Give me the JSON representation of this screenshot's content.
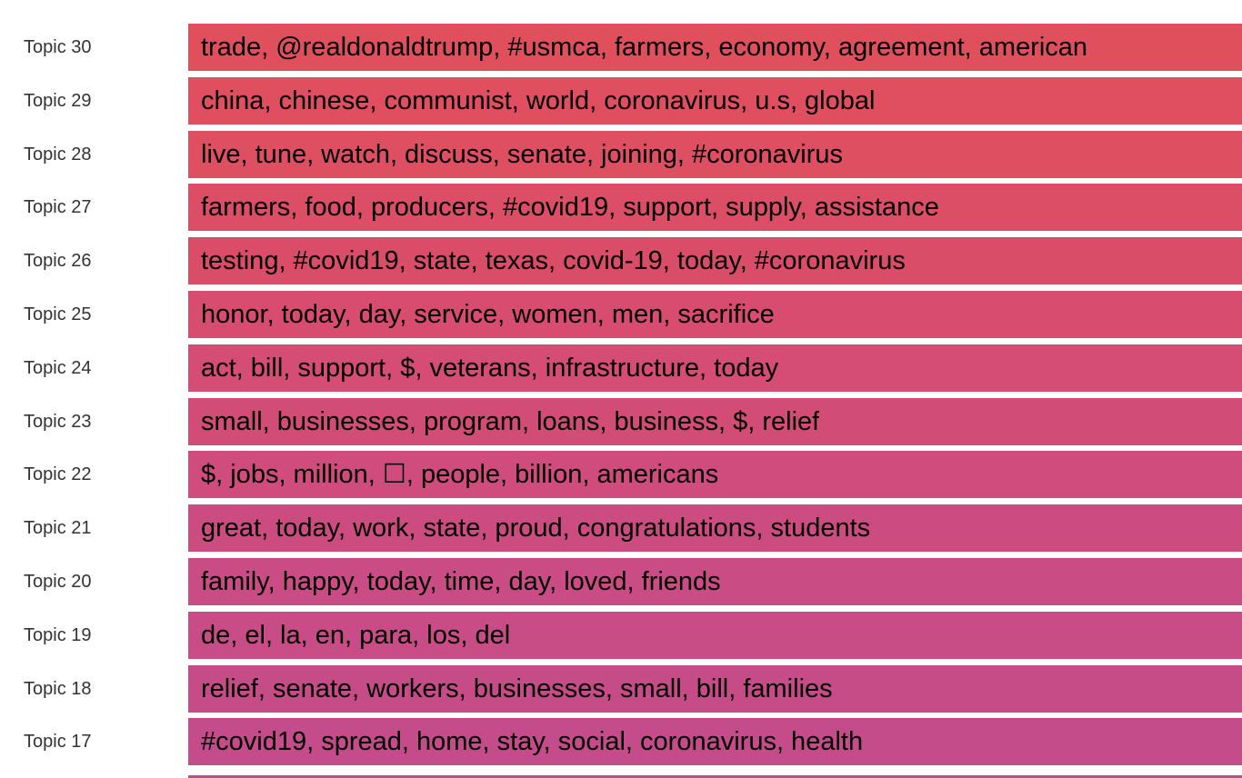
{
  "chart_data": {
    "type": "table",
    "rows": [
      {
        "label": "Topic 30",
        "words": "trade, @realdonaldtrump, #usmca, farmers, economy, agreement, american",
        "color": "#e0505c"
      },
      {
        "label": "Topic 29",
        "words": "china, chinese, communist, world, coronavirus, u.s, global",
        "color": "#df4f5f"
      },
      {
        "label": "Topic 28",
        "words": "live, tune, watch, discuss, senate, joining, #coronavirus",
        "color": "#de4f62"
      },
      {
        "label": "Topic 27",
        "words": "farmers, food, producers, #covid19, support, supply, assistance",
        "color": "#dc4e66"
      },
      {
        "label": "Topic 26",
        "words": "testing, #covid19, state, texas, covid-19, today, #coronavirus",
        "color": "#da4d69"
      },
      {
        "label": "Topic 25",
        "words": "honor, today, day, service, women, men, sacrifice",
        "color": "#d74c6f"
      },
      {
        "label": "Topic 24",
        "words": "act, bill, support, $, veterans, infrastructure, today",
        "color": "#d54c74"
      },
      {
        "label": "Topic 23",
        "words": "small, businesses, program, loans, business, $, relief",
        "color": "#d24c78"
      },
      {
        "label": "Topic 22",
        "words": "$, jobs, million, ☐, people, billion, americans",
        "color": "#cf4c7d"
      },
      {
        "label": "Topic 21",
        "words": "great, today, work, state, proud, congratulations, students",
        "color": "#cc4c81"
      },
      {
        "label": "Topic 20",
        "words": "family, happy, today, time, day, loved, friends",
        "color": "#ca4c84"
      },
      {
        "label": "Topic 19",
        "words": "de, el, la, en, para, los, del",
        "color": "#c84c86"
      },
      {
        "label": "Topic 18",
        "words": "relief, senate, workers, businesses, small, bill, families",
        "color": "#c64c88"
      },
      {
        "label": "Topic 17",
        "words": "#covid19, spread, home, stay, social, coronavirus, health",
        "color": "#c44c8a"
      }
    ],
    "next_row_color": "#c24c8c"
  }
}
